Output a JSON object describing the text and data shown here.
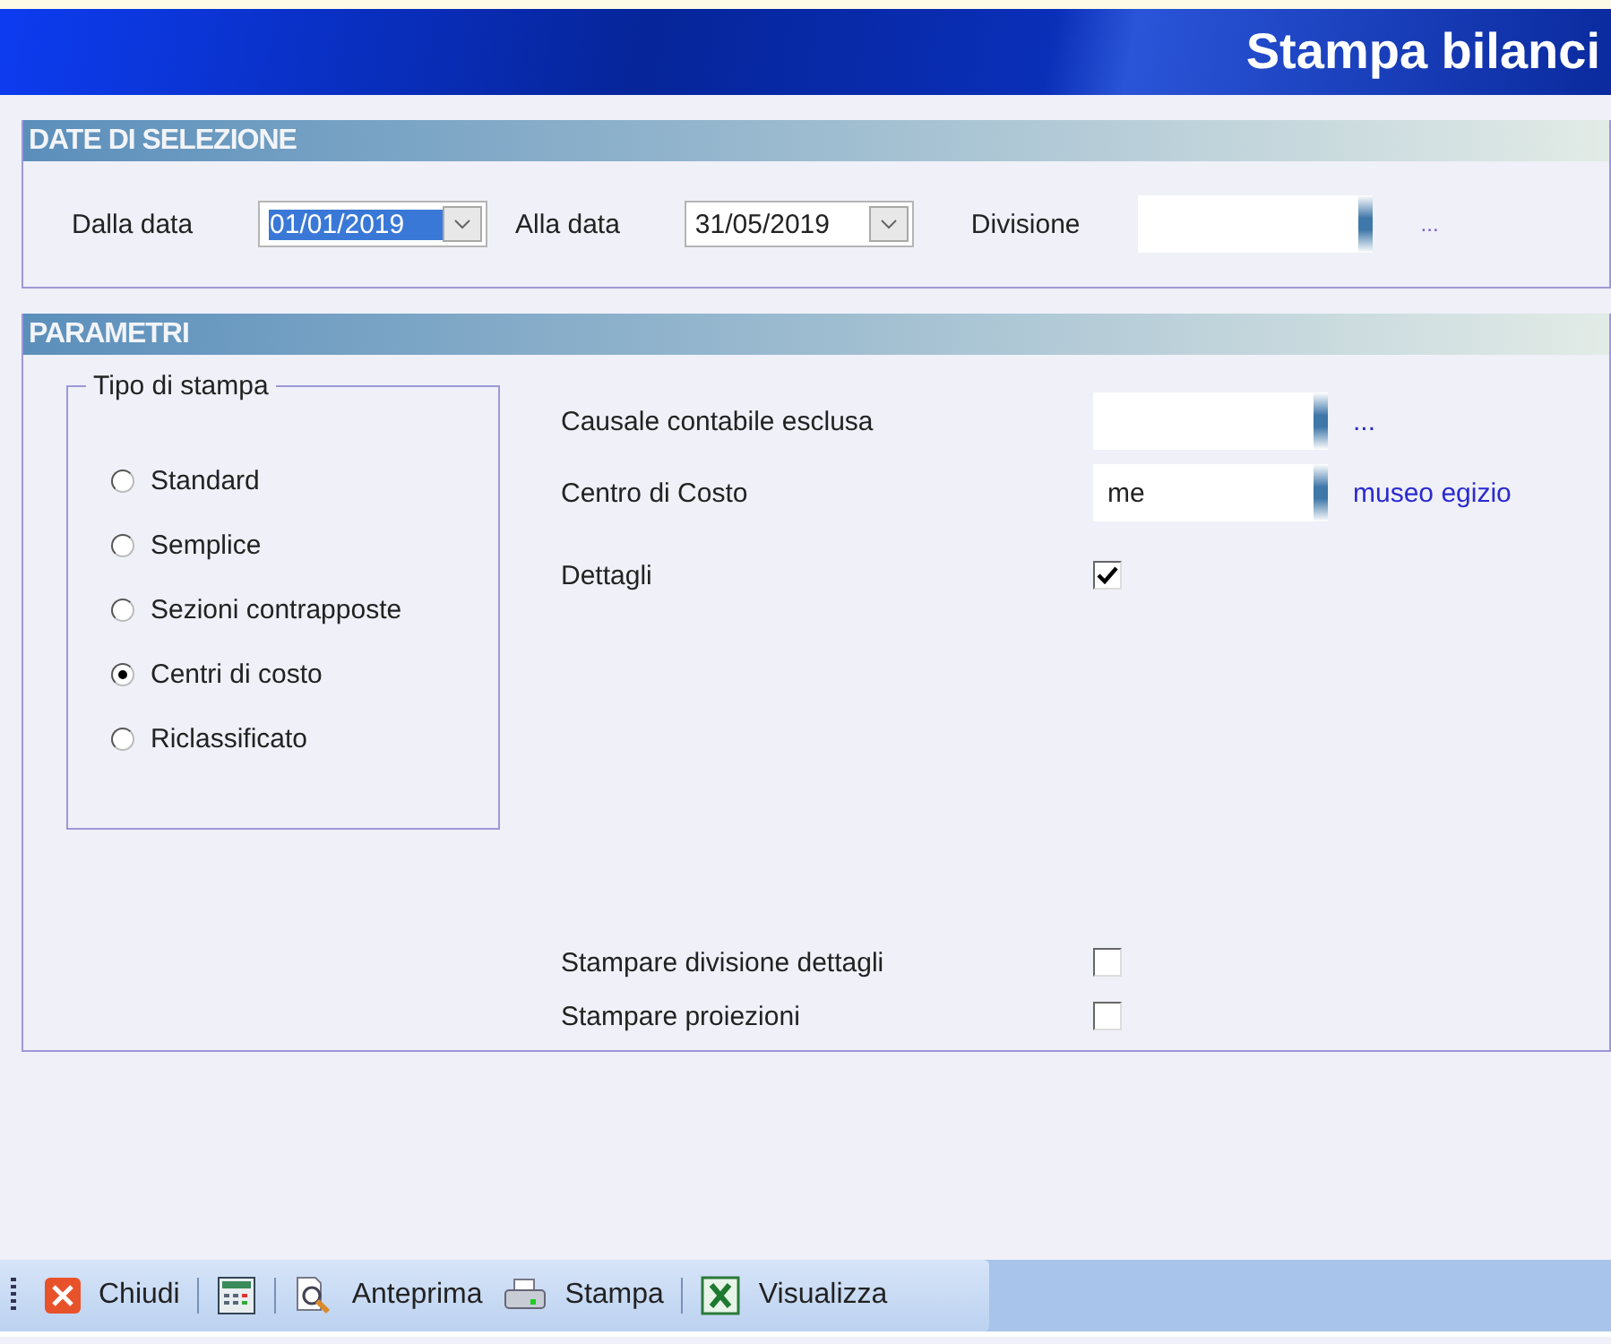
{
  "window": {
    "title": "Stampa bilanci"
  },
  "date_section": {
    "title": "DATE DI SELEZIONE",
    "fields": [
      {
        "kind": "date",
        "label": "Dalla data",
        "value": "01/01/2019",
        "text_selected": true
      },
      {
        "kind": "date",
        "label": "Alla data",
        "value": "31/05/2019",
        "text_selected": false
      },
      {
        "kind": "lookup",
        "label": "Divisione",
        "link": "..."
      }
    ]
  },
  "parameters": {
    "title": "PARAMETRI",
    "print_type": {
      "title": "Tipo di stampa",
      "options": [
        {
          "label": "Standard",
          "selected": false
        },
        {
          "label": "Semplice",
          "selected": false
        },
        {
          "label": "Sezioni contrapposte",
          "selected": false
        },
        {
          "label": "Centri di costo",
          "selected": true
        },
        {
          "label": "Riclassificato",
          "selected": false
        }
      ]
    },
    "top_fields": [
      {
        "kind": "lookup",
        "label": "Causale contabile esclusa",
        "link": "..."
      },
      {
        "kind": "lookup",
        "label": "Centro di Costo",
        "value": "me",
        "link": "museo egizio"
      },
      {
        "kind": "checkbox",
        "label": "Dettagli",
        "checked": true
      }
    ],
    "bottom_fields": [
      {
        "kind": "checkbox",
        "label": "Stampare divisione dettagli",
        "checked": false
      },
      {
        "kind": "checkbox",
        "label": "Stampare proiezioni",
        "checked": false
      }
    ]
  },
  "toolbar": {
    "groups": [
      [
        {
          "kind": "close",
          "label": "Chiudi"
        }
      ],
      [
        {
          "kind": "calculator"
        }
      ],
      [
        {
          "kind": "preview",
          "label": "Anteprima"
        },
        {
          "kind": "print",
          "label": "Stampa"
        }
      ],
      [
        {
          "kind": "excel",
          "label": "Visualizza"
        }
      ]
    ]
  }
}
